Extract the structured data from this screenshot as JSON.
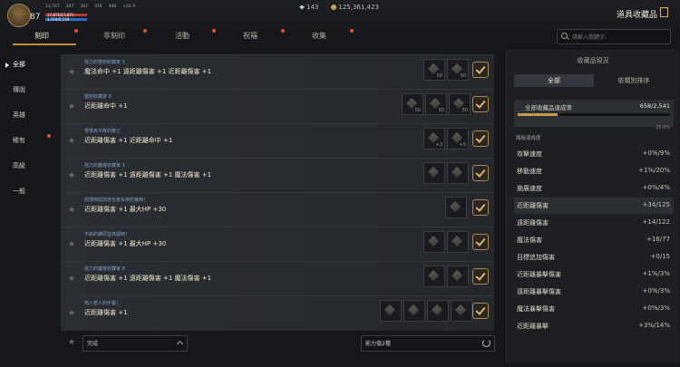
{
  "player": {
    "level": "87",
    "stats": [
      "13,767",
      "367",
      "367",
      "379",
      "448",
      "+32.9"
    ],
    "hp": "17,871/17,871",
    "mp": "2,119/2,119"
  },
  "currency": {
    "gems": "143",
    "coins": "125,361,423"
  },
  "page_title": "道具收藏品",
  "tabs": [
    {
      "label": "刻印"
    },
    {
      "label": "非刻印"
    },
    {
      "label": "活動"
    },
    {
      "label": "祝福"
    },
    {
      "label": "收集"
    }
  ],
  "search": {
    "placeholder": "請輸入關鍵字。"
  },
  "sidebar": [
    {
      "label": "全部"
    },
    {
      "label": "傳說"
    },
    {
      "label": "英雄"
    },
    {
      "label": "稀有"
    },
    {
      "label": "高級"
    },
    {
      "label": "一般"
    }
  ],
  "rows": [
    {
      "sub": "強力的聖劍收藏家 3",
      "main": "魔法命中 +1  遠距離傷害 +1  近距離傷害 +1",
      "slots": [
        "50",
        "50"
      ]
    },
    {
      "sub": "聖劍收藏家 8",
      "main": "近距離命中 +1",
      "slots": [
        "50",
        "50",
        "50"
      ]
    },
    {
      "sub": "雪恨身不敗的戰士",
      "main": "近距離傷害 +1  近距離命中 +1",
      "slots": [
        "+3",
        "+5"
      ]
    },
    {
      "sub": "強力的鐵棍收藏家 3",
      "main": "近距離傷害 +1  遠距離傷害 +1  魔法傷害 +1",
      "slots": [
        "",
        ""
      ]
    },
    {
      "sub": "即便時間流逝也會永存的東西！",
      "main": "近距離傷害 +1  最大HP +30",
      "slots": [
        ""
      ]
    },
    {
      "sub": "不斷的鑽研並高揚吧！",
      "main": "近距離傷害 +1  最大HP +30",
      "slots": [
        "",
        ""
      ]
    },
    {
      "sub": "強力的鐵棍收藏家 8",
      "main": "近距離傷害 +1  遠距離傷害 +1  魔法傷害 +1",
      "slots": [
        "",
        ""
      ]
    },
    {
      "sub": "陪人若人的手藝！",
      "main": "近距離傷害 +1",
      "slots": [
        "",
        "",
        "",
        ""
      ]
    }
  ],
  "bottom": {
    "filter": "完成",
    "ability": "能力值2種"
  },
  "panel": {
    "title": "收藏品現況",
    "tabs": [
      "全部",
      "依類別排序"
    ],
    "overall_label": "全部收藏品達成率",
    "overall_value": "658/2,541",
    "overall_fraction": 0.259,
    "overall_pct": "25.9%",
    "section": "面板達成度",
    "stats": [
      {
        "name": "攻擊速度",
        "value": "+0%/9%"
      },
      {
        "name": "移動速度",
        "value": "+1%/20%"
      },
      {
        "name": "施展速度",
        "value": "+0%/4%"
      },
      {
        "name": "近距離傷害",
        "value": "+34/125"
      },
      {
        "name": "遠距離傷害",
        "value": "+14/122"
      },
      {
        "name": "魔法傷害",
        "value": "+16/77"
      },
      {
        "name": "目標追加傷害",
        "value": "+0/15"
      },
      {
        "name": "近距離暴擊傷害",
        "value": "+1%/3%"
      },
      {
        "name": "遠距離暴擊傷害",
        "value": "+0%/3%"
      },
      {
        "name": "魔法暴擊傷害",
        "value": "+0%/3%"
      },
      {
        "name": "近距離暴擊",
        "value": "+3%/14%"
      }
    ]
  }
}
